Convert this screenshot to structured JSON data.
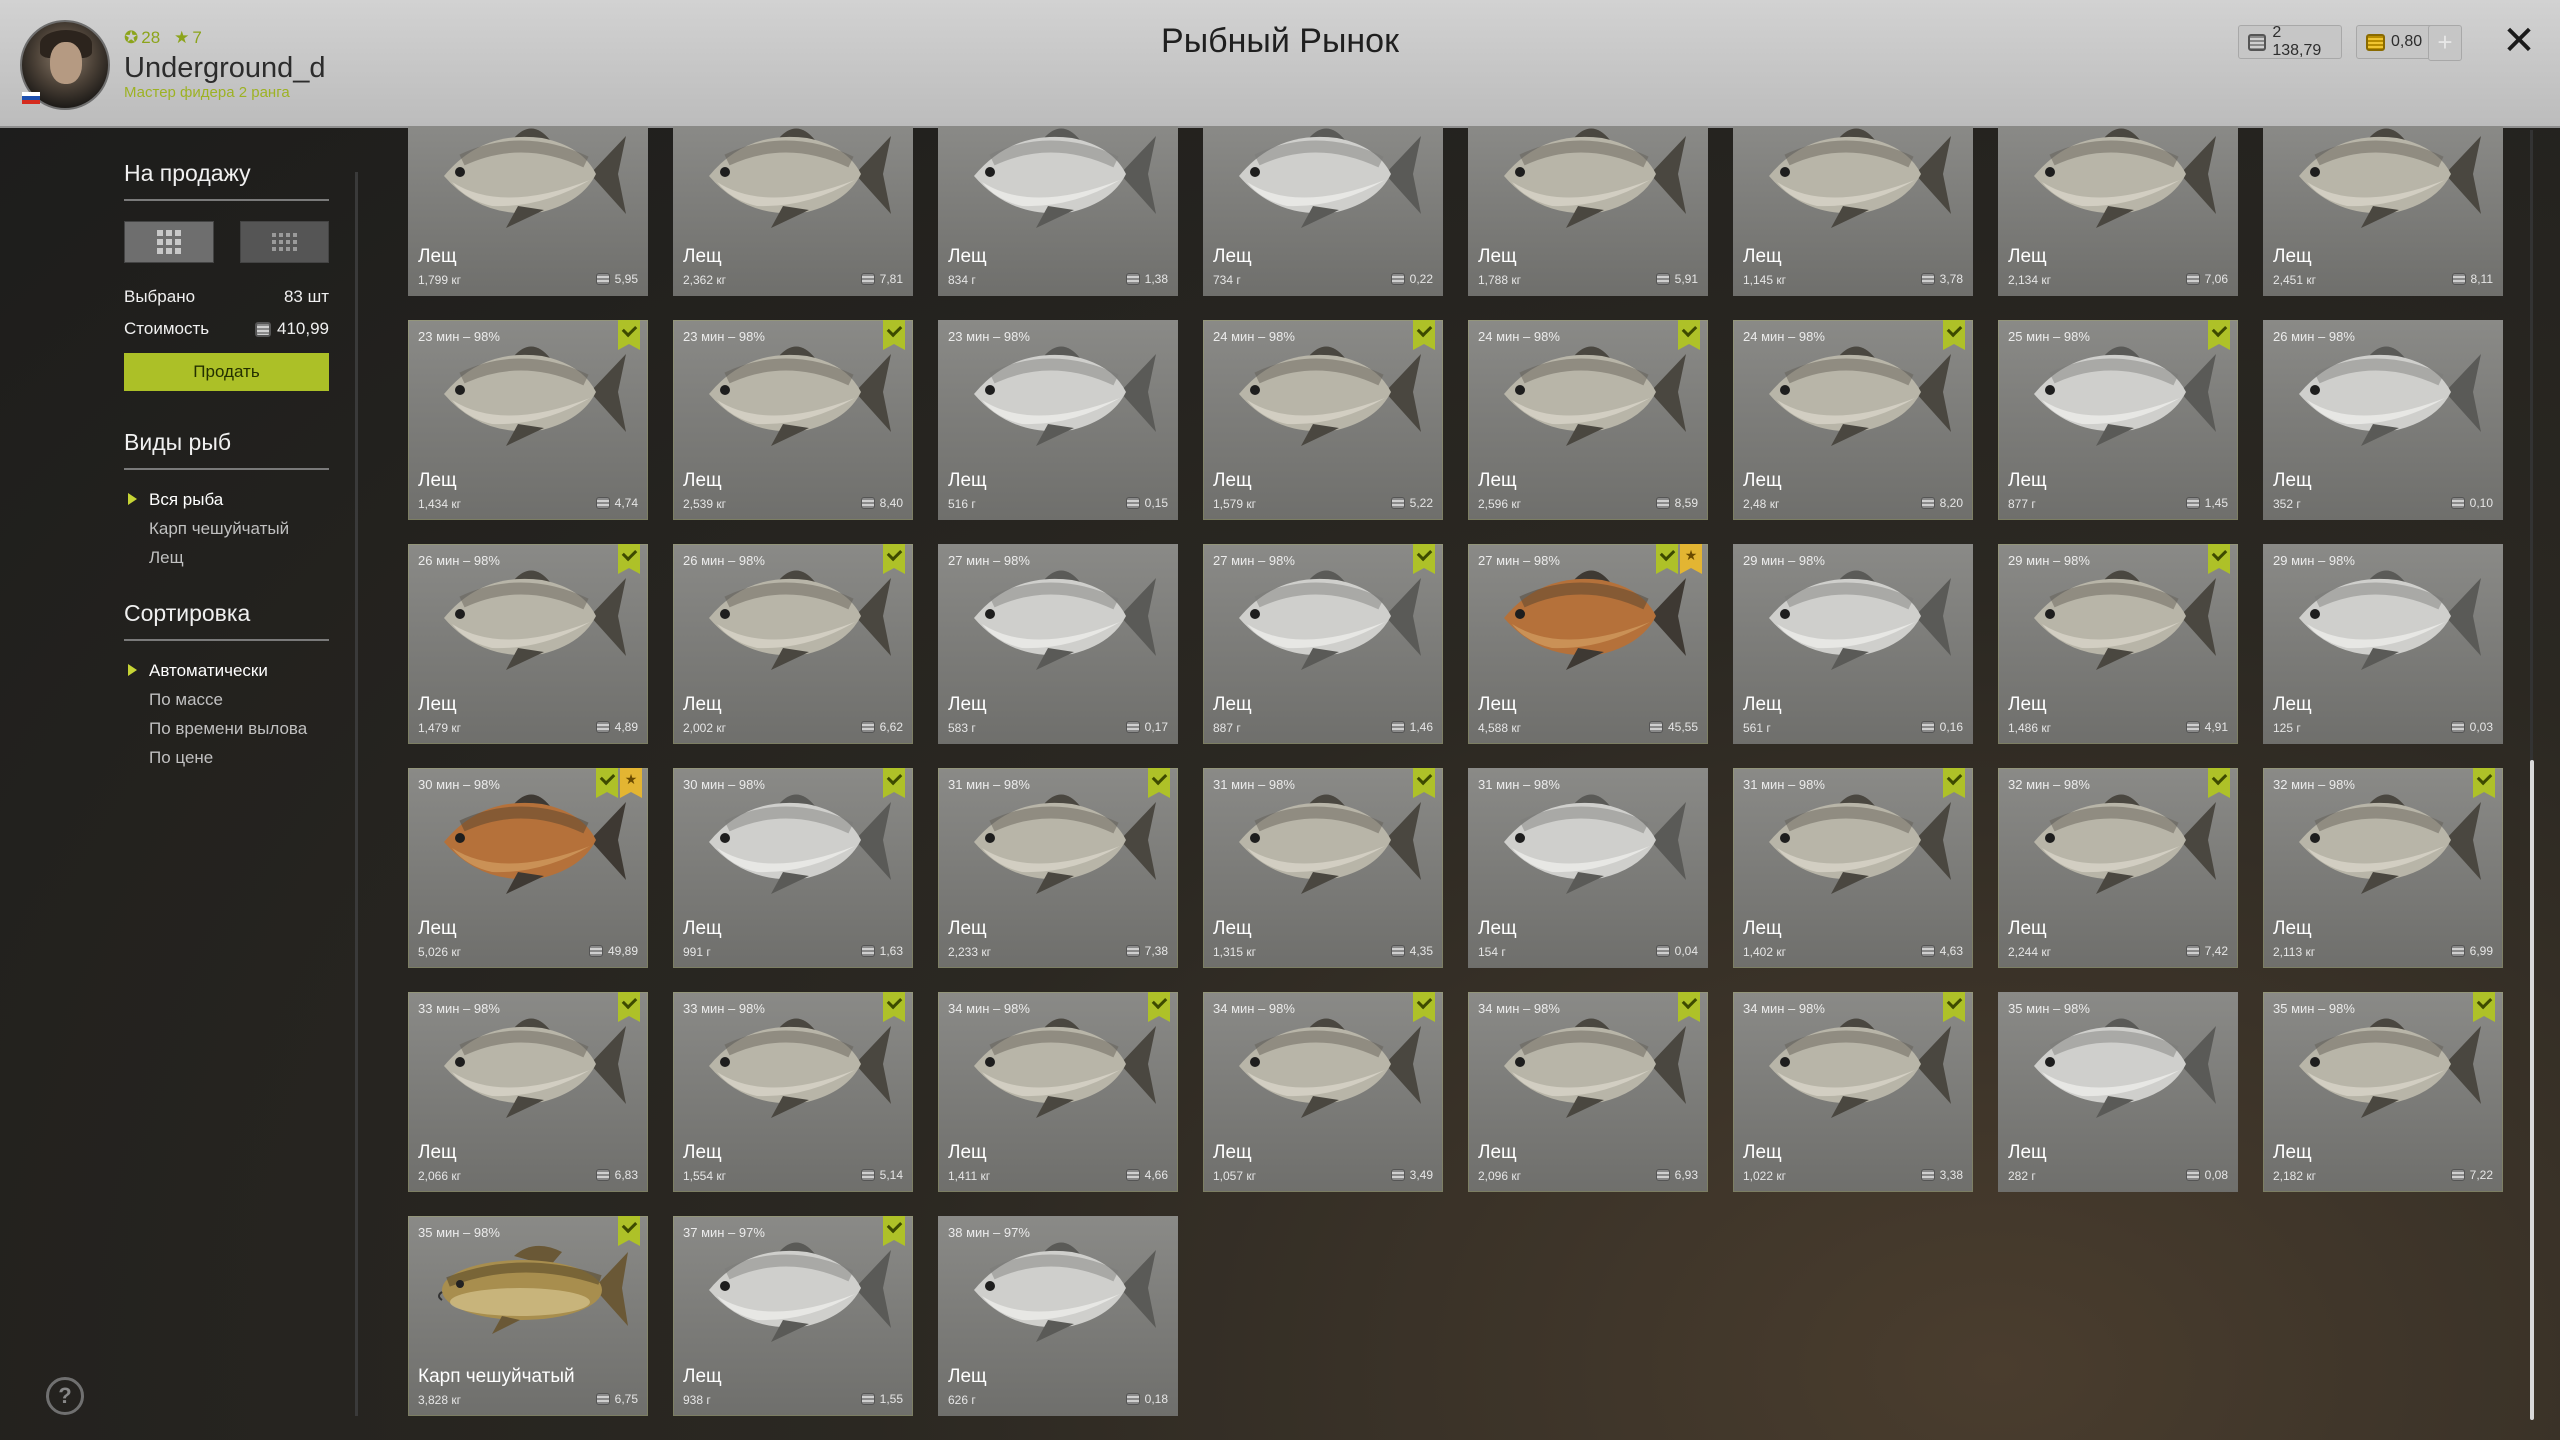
{
  "header": {
    "title": "Рыбный Рынок",
    "player": {
      "name": "Underground_d",
      "rank": "Мастер фидера 2 ранга",
      "level": "28",
      "stars": "7",
      "level_icon": "circle-level-icon",
      "stars_icon": "star-icon"
    },
    "currency": {
      "silver": "2 138,79",
      "gold": "0,80"
    },
    "add_currency_label": "+",
    "close_label": "✕"
  },
  "sidebar": {
    "for_sale_heading": "На продажу",
    "selected_label": "Выбрано",
    "selected_value": "83 шт",
    "cost_label": "Стоимость",
    "cost_value": "410,99",
    "sell_button": "Продать",
    "species_heading": "Виды рыб",
    "species": [
      "Вся рыба",
      "Карп чешуйчатый",
      "Лещ"
    ],
    "species_active": 0,
    "sort_heading": "Сортировка",
    "sort_options": [
      "Автоматически",
      "По массе",
      "По времени вылова",
      "По цене"
    ],
    "sort_active": 0
  },
  "colors": {
    "accent": "#acc027",
    "star": "#e3b532",
    "card": "#7f7f7c"
  },
  "fish": [
    {
      "time": "",
      "name": "Лещ",
      "weight": "1,799 кг",
      "price": "5,95",
      "check": false,
      "star": false,
      "tone": "silver"
    },
    {
      "time": "",
      "name": "Лещ",
      "weight": "2,362 кг",
      "price": "7,81",
      "check": false,
      "star": false,
      "tone": "silver"
    },
    {
      "time": "",
      "name": "Лещ",
      "weight": "834 г",
      "price": "1,38",
      "check": false,
      "star": false,
      "tone": "white"
    },
    {
      "time": "",
      "name": "Лещ",
      "weight": "734 г",
      "price": "0,22",
      "check": false,
      "star": false,
      "tone": "white"
    },
    {
      "time": "",
      "name": "Лещ",
      "weight": "1,788 кг",
      "price": "5,91",
      "check": false,
      "star": false,
      "tone": "silver"
    },
    {
      "time": "",
      "name": "Лещ",
      "weight": "1,145 кг",
      "price": "3,78",
      "check": false,
      "star": false,
      "tone": "silver"
    },
    {
      "time": "",
      "name": "Лещ",
      "weight": "2,134 кг",
      "price": "7,06",
      "check": false,
      "star": false,
      "tone": "silver"
    },
    {
      "time": "",
      "name": "Лещ",
      "weight": "2,451 кг",
      "price": "8,11",
      "check": false,
      "star": false,
      "tone": "silver"
    },
    {
      "time": "23 мин – 98%",
      "name": "Лещ",
      "weight": "1,434 кг",
      "price": "4,74",
      "check": true,
      "star": false,
      "tone": "silver"
    },
    {
      "time": "23 мин – 98%",
      "name": "Лещ",
      "weight": "2,539 кг",
      "price": "8,40",
      "check": true,
      "star": false,
      "tone": "silver"
    },
    {
      "time": "23 мин – 98%",
      "name": "Лещ",
      "weight": "516 г",
      "price": "0,15",
      "check": false,
      "star": false,
      "tone": "white"
    },
    {
      "time": "24 мин – 98%",
      "name": "Лещ",
      "weight": "1,579 кг",
      "price": "5,22",
      "check": true,
      "star": false,
      "tone": "silver"
    },
    {
      "time": "24 мин – 98%",
      "name": "Лещ",
      "weight": "2,596 кг",
      "price": "8,59",
      "check": true,
      "star": false,
      "tone": "silver"
    },
    {
      "time": "24 мин – 98%",
      "name": "Лещ",
      "weight": "2,48 кг",
      "price": "8,20",
      "check": true,
      "star": false,
      "tone": "silver"
    },
    {
      "time": "25 мин – 98%",
      "name": "Лещ",
      "weight": "877 г",
      "price": "1,45",
      "check": true,
      "star": false,
      "tone": "white"
    },
    {
      "time": "26 мин – 98%",
      "name": "Лещ",
      "weight": "352 г",
      "price": "0,10",
      "check": false,
      "star": false,
      "tone": "white"
    },
    {
      "time": "26 мин – 98%",
      "name": "Лещ",
      "weight": "1,479 кг",
      "price": "4,89",
      "check": true,
      "star": false,
      "tone": "silver"
    },
    {
      "time": "26 мин – 98%",
      "name": "Лещ",
      "weight": "2,002 кг",
      "price": "6,62",
      "check": true,
      "star": false,
      "tone": "silver"
    },
    {
      "time": "27 мин – 98%",
      "name": "Лещ",
      "weight": "583 г",
      "price": "0,17",
      "check": false,
      "star": false,
      "tone": "white"
    },
    {
      "time": "27 мин – 98%",
      "name": "Лещ",
      "weight": "887 г",
      "price": "1,46",
      "check": true,
      "star": false,
      "tone": "white"
    },
    {
      "time": "27 мин – 98%",
      "name": "Лещ",
      "weight": "4,588 кг",
      "price": "45,55",
      "check": true,
      "star": true,
      "tone": "bronze"
    },
    {
      "time": "29 мин – 98%",
      "name": "Лещ",
      "weight": "561 г",
      "price": "0,16",
      "check": false,
      "star": false,
      "tone": "white"
    },
    {
      "time": "29 мин – 98%",
      "name": "Лещ",
      "weight": "1,486 кг",
      "price": "4,91",
      "check": true,
      "star": false,
      "tone": "silver"
    },
    {
      "time": "29 мин – 98%",
      "name": "Лещ",
      "weight": "125 г",
      "price": "0,03",
      "check": false,
      "star": false,
      "tone": "white"
    },
    {
      "time": "30 мин – 98%",
      "name": "Лещ",
      "weight": "5,026 кг",
      "price": "49,89",
      "check": true,
      "star": true,
      "tone": "bronze"
    },
    {
      "time": "30 мин – 98%",
      "name": "Лещ",
      "weight": "991 г",
      "price": "1,63",
      "check": true,
      "star": false,
      "tone": "white"
    },
    {
      "time": "31 мин – 98%",
      "name": "Лещ",
      "weight": "2,233 кг",
      "price": "7,38",
      "check": true,
      "star": false,
      "tone": "silver"
    },
    {
      "time": "31 мин – 98%",
      "name": "Лещ",
      "weight": "1,315 кг",
      "price": "4,35",
      "check": true,
      "star": false,
      "tone": "silver"
    },
    {
      "time": "31 мин – 98%",
      "name": "Лещ",
      "weight": "154 г",
      "price": "0,04",
      "check": false,
      "star": false,
      "tone": "white"
    },
    {
      "time": "31 мин – 98%",
      "name": "Лещ",
      "weight": "1,402 кг",
      "price": "4,63",
      "check": true,
      "star": false,
      "tone": "silver"
    },
    {
      "time": "32 мин – 98%",
      "name": "Лещ",
      "weight": "2,244 кг",
      "price": "7,42",
      "check": true,
      "star": false,
      "tone": "silver"
    },
    {
      "time": "32 мин – 98%",
      "name": "Лещ",
      "weight": "2,113 кг",
      "price": "6,99",
      "check": true,
      "star": false,
      "tone": "silver"
    },
    {
      "time": "33 мин – 98%",
      "name": "Лещ",
      "weight": "2,066 кг",
      "price": "6,83",
      "check": true,
      "star": false,
      "tone": "silver"
    },
    {
      "time": "33 мин – 98%",
      "name": "Лещ",
      "weight": "1,554 кг",
      "price": "5,14",
      "check": true,
      "star": false,
      "tone": "silver"
    },
    {
      "time": "34 мин – 98%",
      "name": "Лещ",
      "weight": "1,411 кг",
      "price": "4,66",
      "check": true,
      "star": false,
      "tone": "silver"
    },
    {
      "time": "34 мин – 98%",
      "name": "Лещ",
      "weight": "1,057 кг",
      "price": "3,49",
      "check": true,
      "star": false,
      "tone": "silver"
    },
    {
      "time": "34 мин – 98%",
      "name": "Лещ",
      "weight": "2,096 кг",
      "price": "6,93",
      "check": true,
      "star": false,
      "tone": "silver"
    },
    {
      "time": "34 мин – 98%",
      "name": "Лещ",
      "weight": "1,022 кг",
      "price": "3,38",
      "check": true,
      "star": false,
      "tone": "silver"
    },
    {
      "time": "35 мин – 98%",
      "name": "Лещ",
      "weight": "282 г",
      "price": "0,08",
      "check": false,
      "star": false,
      "tone": "white"
    },
    {
      "time": "35 мин – 98%",
      "name": "Лещ",
      "weight": "2,182 кг",
      "price": "7,22",
      "check": true,
      "star": false,
      "tone": "silver"
    },
    {
      "time": "35 мин – 98%",
      "name": "Карп чешуйчатый",
      "weight": "3,828 кг",
      "price": "6,75",
      "check": true,
      "star": false,
      "tone": "carp"
    },
    {
      "time": "37 мин – 97%",
      "name": "Лещ",
      "weight": "938 г",
      "price": "1,55",
      "check": true,
      "star": false,
      "tone": "white"
    },
    {
      "time": "38 мин – 97%",
      "name": "Лещ",
      "weight": "626 г",
      "price": "0,18",
      "check": false,
      "star": false,
      "tone": "white"
    }
  ]
}
